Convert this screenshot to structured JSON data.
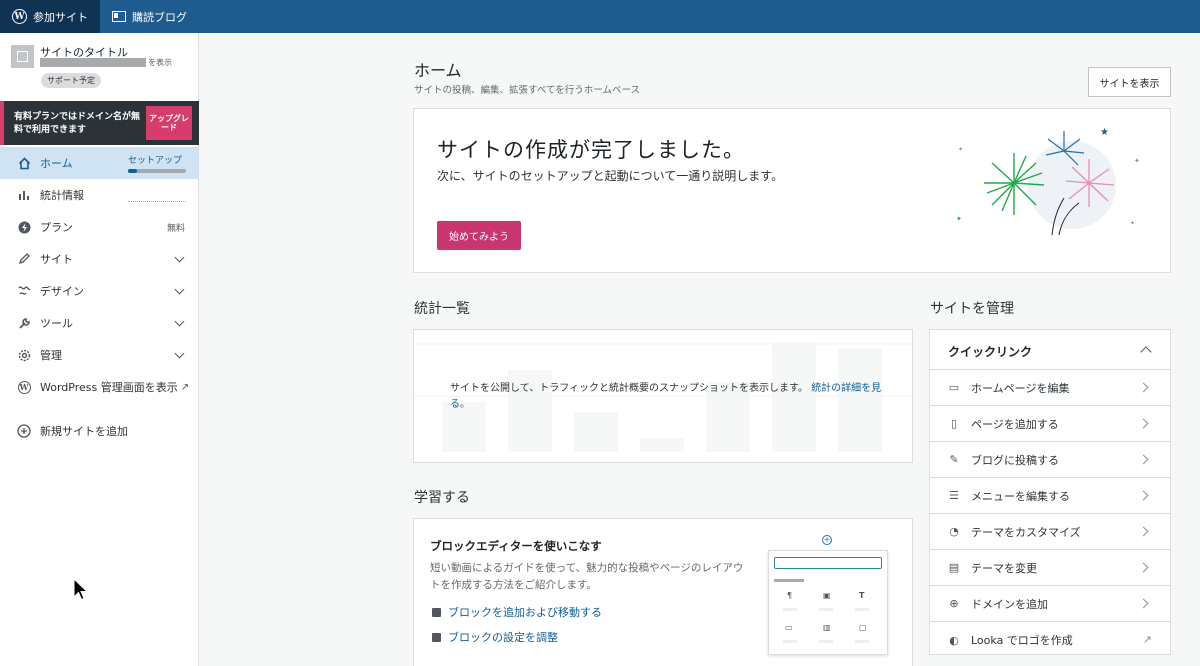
{
  "masterbar": {
    "my_sites_label": "参加サイト",
    "reader_label": "購読ブログ"
  },
  "sidebar": {
    "site_title": "サイトのタイトル",
    "site_url_suffix": "を表示",
    "support_badge": "サポート予定",
    "upsell_text": "有料プランではドメイン名が無料で利用できます",
    "upgrade_label": "アップグレード",
    "items": [
      {
        "label": "ホーム",
        "right": "セットアップ",
        "icon": "home-icon"
      },
      {
        "label": "統計情報",
        "right": "",
        "icon": "stats-icon"
      },
      {
        "label": "プラン",
        "right": "無料",
        "icon": "plan-icon"
      },
      {
        "label": "サイト",
        "right": "",
        "icon": "pencil-icon"
      },
      {
        "label": "デザイン",
        "right": "",
        "icon": "design-icon"
      },
      {
        "label": "ツール",
        "right": "",
        "icon": "wrench-icon"
      },
      {
        "label": "管理",
        "right": "",
        "icon": "gear-icon"
      },
      {
        "label": "WordPress 管理画面を表示",
        "right": "",
        "icon": "wp-icon"
      },
      {
        "label": "新規サイトを追加",
        "right": "",
        "icon": "plus-circle-icon"
      }
    ],
    "setup_progress": 0.15
  },
  "main": {
    "page_title": "ホーム",
    "page_subtitle": "サイトの投稿、編集、拡張すべてを行うホームベース",
    "view_site_button": "サイトを表示",
    "hero": {
      "title": "サイトの作成が完了しました。",
      "subtitle": "次に、サイトのセットアップと起動について一通り説明します。",
      "button": "始めてみよう"
    },
    "stats": {
      "section_title": "統計一覧",
      "message": "サイトを公開して、トラフィックと統計概要のスナップショットを表示します。",
      "link": "統計の詳細を見る。"
    },
    "learn": {
      "section_title": "学習する",
      "title": "ブロックエディターを使いこなす",
      "description": "短い動画によるガイドを使って、魅力的な投稿やページのレイアウトを作成する方法をご紹介します。",
      "links": [
        "ブロックを追加および移動する",
        "ブロックの設定を調整"
      ]
    },
    "manage": {
      "section_title": "サイトを管理",
      "quick_links_title": "クイックリンク",
      "items": [
        {
          "label": "ホームページを編集",
          "icon": "laptop-icon"
        },
        {
          "label": "ページを追加する",
          "icon": "page-icon"
        },
        {
          "label": "ブログに投稿する",
          "icon": "pencil-icon"
        },
        {
          "label": "メニューを編集する",
          "icon": "menu-icon"
        },
        {
          "label": "テーマをカスタマイズ",
          "icon": "palette-icon"
        },
        {
          "label": "テーマを変更",
          "icon": "theme-icon"
        },
        {
          "label": "ドメインを追加",
          "icon": "globe-icon"
        },
        {
          "label": "Looka でロゴを作成",
          "icon": "looka-icon"
        }
      ]
    }
  }
}
